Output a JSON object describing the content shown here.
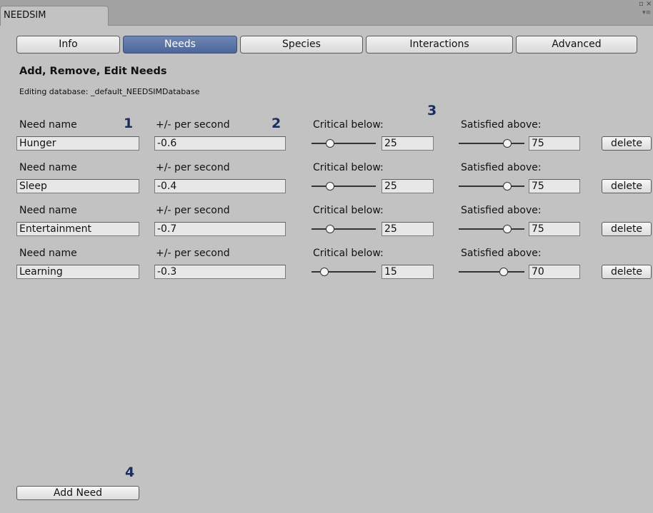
{
  "window": {
    "tab_title": "NEEDSIM",
    "restore_glyph": "▫",
    "close_glyph": "×",
    "menu_glyph": "▾≡"
  },
  "tabs": [
    {
      "label": "Info",
      "active": false
    },
    {
      "label": "Needs",
      "active": true
    },
    {
      "label": "Species",
      "active": false
    },
    {
      "label": "Interactions",
      "active": false
    },
    {
      "label": "Advanced",
      "active": false
    }
  ],
  "section": {
    "title": "Add, Remove, Edit Needs",
    "database_info": "Editing database: _default_NEEDSIMDatabase"
  },
  "column_labels": {
    "name": "Need name",
    "rate": "+/- per second",
    "critical": "Critical below:",
    "satisfied": "Satisfied above:"
  },
  "needs": [
    {
      "name": "Hunger",
      "rate": "-0.6",
      "critical": "25",
      "satisfied": "75",
      "delete_label": "delete"
    },
    {
      "name": "Sleep",
      "rate": "-0.4",
      "critical": "25",
      "satisfied": "75",
      "delete_label": "delete"
    },
    {
      "name": "Entertainment",
      "rate": "-0.7",
      "critical": "25",
      "satisfied": "75",
      "delete_label": "delete"
    },
    {
      "name": "Learning",
      "rate": "-0.3",
      "critical": "15",
      "satisfied": "70",
      "delete_label": "delete"
    }
  ],
  "annotations": [
    "1",
    "2",
    "3",
    "4"
  ],
  "add_button_label": "Add Need"
}
